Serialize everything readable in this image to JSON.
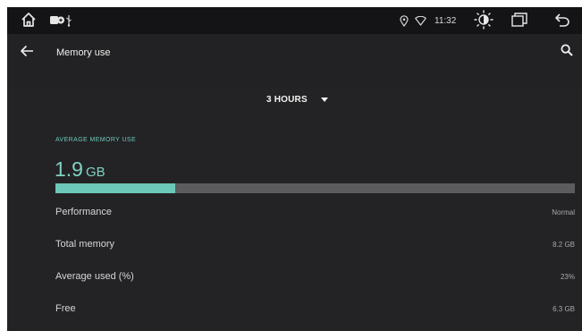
{
  "status_bar": {
    "time": "11:32",
    "icons": [
      "home-icon",
      "wifi-card-icon",
      "usb-icon",
      "location-icon",
      "wifi-signal-icon",
      "brightness-icon",
      "recent-apps-icon",
      "back-icon"
    ]
  },
  "app_bar": {
    "title": "Memory use",
    "icons": [
      "back-arrow-icon",
      "search-icon"
    ]
  },
  "time_range": {
    "selected": "3 HOURS",
    "icon": "dropdown-arrow-icon"
  },
  "summary": {
    "header": "AVERAGE MEMORY USE",
    "value": "1.9",
    "unit": "GB",
    "usage_fraction": 0.23,
    "accent_color": "#6cc8b8"
  },
  "details": [
    {
      "label": "Performance",
      "value": "Normal"
    },
    {
      "label": "Total memory",
      "value": "8.2 GB"
    },
    {
      "label": "Average used (%)",
      "value": "23%"
    },
    {
      "label": "Free",
      "value": "6.3 GB"
    }
  ]
}
